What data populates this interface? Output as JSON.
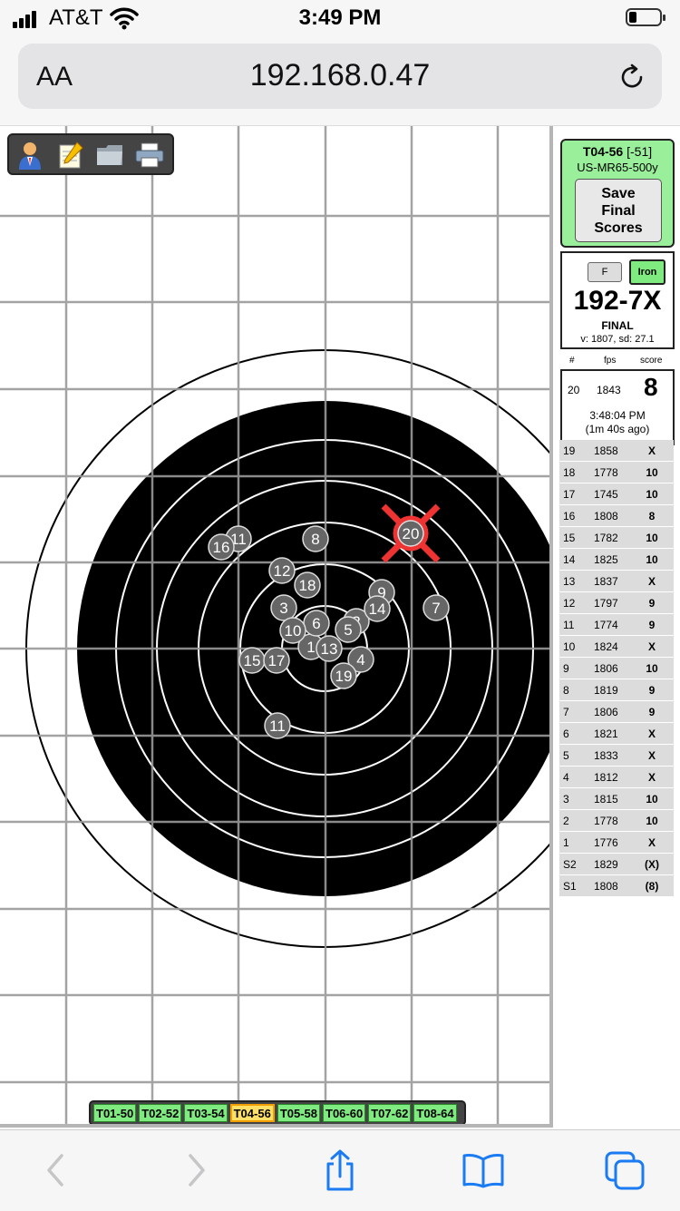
{
  "status_bar": {
    "carrier": "AT&T",
    "time": "3:49 PM"
  },
  "browser": {
    "text_size_label": "AA",
    "url": "192.168.0.47"
  },
  "toolbar": {
    "icons": [
      "user-icon",
      "notepad-icon",
      "folder-icon",
      "printer-icon"
    ]
  },
  "target": {
    "shots": [
      {
        "label": "1"
      },
      {
        "label": "2"
      },
      {
        "label": "3"
      },
      {
        "label": "4"
      },
      {
        "label": "5"
      },
      {
        "label": "6"
      },
      {
        "label": "7"
      },
      {
        "label": "8"
      },
      {
        "label": "9"
      },
      {
        "label": "10"
      },
      {
        "label": "11"
      },
      {
        "label": "11"
      },
      {
        "label": "12"
      },
      {
        "label": "13"
      },
      {
        "label": "14"
      },
      {
        "label": "15"
      },
      {
        "label": "16"
      },
      {
        "label": "17"
      },
      {
        "label": "18"
      },
      {
        "label": "19"
      },
      {
        "label": "20"
      }
    ],
    "highlight_color": "#ee3333"
  },
  "target_tabs": {
    "tabs": [
      "T01-50",
      "T02-52",
      "T03-54",
      "T04-56",
      "T05-58",
      "T06-60",
      "T07-62",
      "T08-64"
    ],
    "active": "T04-56"
  },
  "panel": {
    "target_name": "T04-56",
    "target_offset": "[-51]",
    "course": "US-MR65-500y",
    "save_button": "Save\nFinal\nScores",
    "f_button": "F",
    "iron_button": "Iron",
    "total": "192-7X",
    "status": "FINAL",
    "velocity_stats": "v: 1807, sd: 27.1",
    "headers": {
      "num": "#",
      "fps": "fps",
      "score": "score"
    },
    "last_shot": {
      "num": "20",
      "fps": "1843",
      "score": "8",
      "time": "3:48:04 PM",
      "ago": "(1m 40s ago)"
    },
    "shots": [
      {
        "num": "19",
        "fps": "1858",
        "score": "X"
      },
      {
        "num": "18",
        "fps": "1778",
        "score": "10"
      },
      {
        "num": "17",
        "fps": "1745",
        "score": "10"
      },
      {
        "num": "16",
        "fps": "1808",
        "score": "8"
      },
      {
        "num": "15",
        "fps": "1782",
        "score": "10"
      },
      {
        "num": "14",
        "fps": "1825",
        "score": "10"
      },
      {
        "num": "13",
        "fps": "1837",
        "score": "X"
      },
      {
        "num": "12",
        "fps": "1797",
        "score": "9"
      },
      {
        "num": "11",
        "fps": "1774",
        "score": "9"
      },
      {
        "num": "10",
        "fps": "1824",
        "score": "X"
      },
      {
        "num": "9",
        "fps": "1806",
        "score": "10"
      },
      {
        "num": "8",
        "fps": "1819",
        "score": "9"
      },
      {
        "num": "7",
        "fps": "1806",
        "score": "9"
      },
      {
        "num": "6",
        "fps": "1821",
        "score": "X"
      },
      {
        "num": "5",
        "fps": "1833",
        "score": "X"
      },
      {
        "num": "4",
        "fps": "1812",
        "score": "X"
      },
      {
        "num": "3",
        "fps": "1815",
        "score": "10"
      },
      {
        "num": "2",
        "fps": "1778",
        "score": "10"
      },
      {
        "num": "1",
        "fps": "1776",
        "score": "X"
      },
      {
        "num": "S2",
        "fps": "1829",
        "score": "(X)"
      },
      {
        "num": "S1",
        "fps": "1808",
        "score": "(8)"
      }
    ]
  },
  "bottom_bar": {
    "icons": [
      "back-arrow-icon",
      "forward-arrow-icon",
      "share-icon",
      "bookmarks-icon",
      "tabs-icon"
    ]
  }
}
